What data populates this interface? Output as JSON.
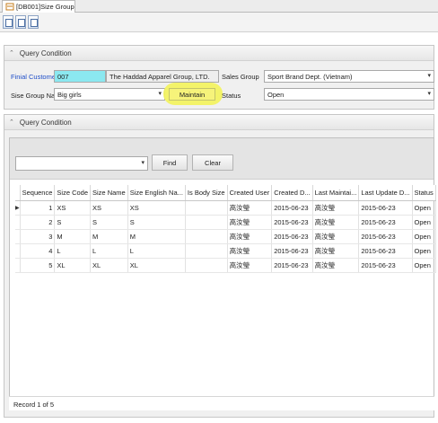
{
  "tab": {
    "title": "[DB001]Size Group",
    "close": "×"
  },
  "toolbar": {
    "buttons": [
      "add-doc-icon",
      "edit-doc-icon",
      "export-doc-icon"
    ]
  },
  "query_panel": {
    "title": "Query Condition",
    "finial_customer_label": "Finial Customer",
    "customer_code": "007",
    "customer_name": "The Haddad Apparel Group, LTD.",
    "sales_group_label": "Sales Group",
    "sales_group_value": "Sport Brand Dept. (Vietnam)",
    "size_group_name_label": "Sise Group Name",
    "size_group_name_value": "Big girls",
    "maintain_label": "Maintain",
    "status_label": "Status",
    "status_value": "Open"
  },
  "grid_panel": {
    "title": "Query Condition",
    "find_label": "Find",
    "clear_label": "Clear",
    "columns": [
      "Sequence",
      "Size Code",
      "Size Name",
      "Size English Na...",
      "Is Body Size",
      "Created User",
      "Created D...",
      "Last Maintai...",
      "Last Update D...",
      "Status"
    ],
    "rows": [
      {
        "seq": "1",
        "code": "XS",
        "name": "XS",
        "en": "XS",
        "body": "",
        "cuser": "高汝瑩",
        "cdate": "2015-06-23",
        "muser": "高汝瑩",
        "udate": "2015-06-23",
        "status": "Open"
      },
      {
        "seq": "2",
        "code": "S",
        "name": "S",
        "en": "S",
        "body": "",
        "cuser": "高汝瑩",
        "cdate": "2015-06-23",
        "muser": "高汝瑩",
        "udate": "2015-06-23",
        "status": "Open"
      },
      {
        "seq": "3",
        "code": "M",
        "name": "M",
        "en": "M",
        "body": "",
        "cuser": "高汝瑩",
        "cdate": "2015-06-23",
        "muser": "高汝瑩",
        "udate": "2015-06-23",
        "status": "Open"
      },
      {
        "seq": "4",
        "code": "L",
        "name": "L",
        "en": "L",
        "body": "",
        "cuser": "高汝瑩",
        "cdate": "2015-06-23",
        "muser": "高汝瑩",
        "udate": "2015-06-23",
        "status": "Open"
      },
      {
        "seq": "5",
        "code": "XL",
        "name": "XL",
        "en": "XL",
        "body": "",
        "cuser": "高汝瑩",
        "cdate": "2015-06-23",
        "muser": "高汝瑩",
        "udate": "2015-06-23",
        "status": "Open"
      }
    ],
    "current_row_marker": "▶",
    "record_status": "Record 1 of 5"
  },
  "colors": {
    "customer_code_bg": "#8be8f0",
    "maintain_highlight": "#f3f35a",
    "label_blue": "#1f4ec8"
  }
}
